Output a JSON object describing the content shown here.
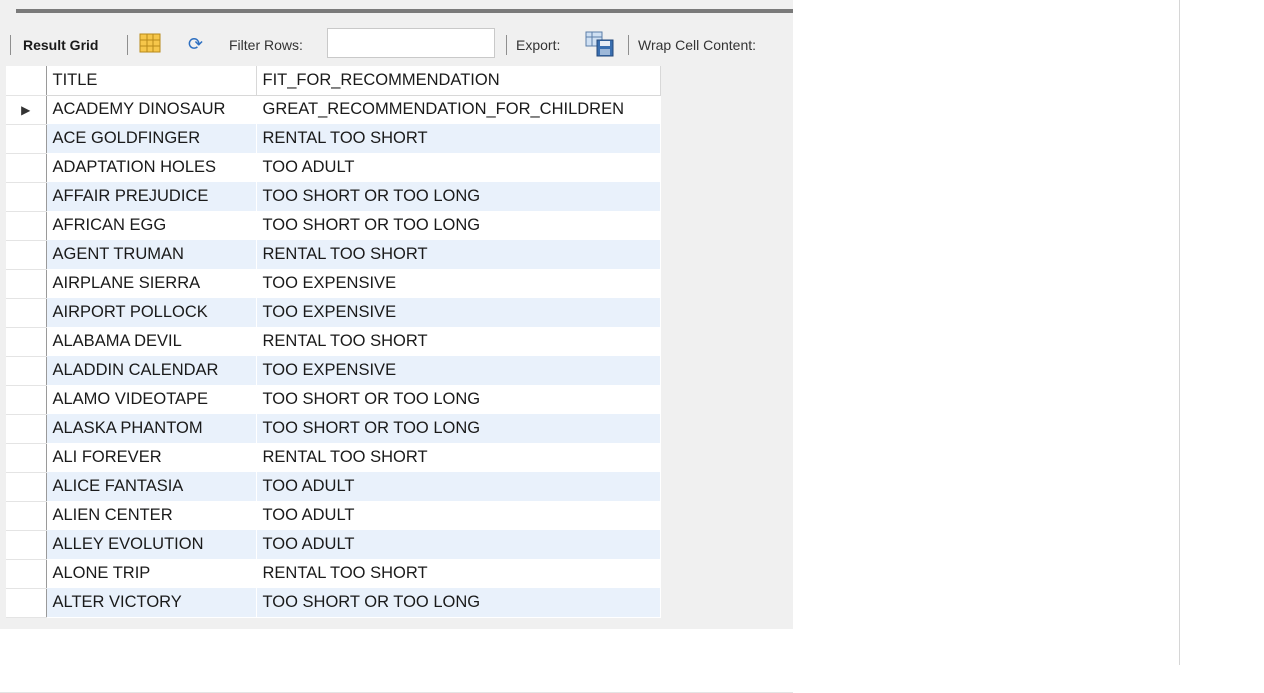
{
  "toolbar": {
    "result_grid_label": "Result Grid",
    "filter_rows_label": "Filter Rows:",
    "filter_value": "",
    "export_label": "Export:",
    "wrap_label": "Wrap Cell Content:",
    "icons": [
      "grid-layout-icon",
      "refresh-icon",
      "export-icon"
    ]
  },
  "grid": {
    "columns": [
      "TITLE",
      "FIT_FOR_RECOMMENDATION"
    ],
    "current_row_marker": "▶",
    "rows": [
      [
        "ACADEMY DINOSAUR",
        "GREAT_RECOMMENDATION_FOR_CHILDREN"
      ],
      [
        "ACE GOLDFINGER",
        "RENTAL TOO SHORT"
      ],
      [
        "ADAPTATION HOLES",
        "TOO ADULT"
      ],
      [
        "AFFAIR PREJUDICE",
        "TOO SHORT OR TOO LONG"
      ],
      [
        "AFRICAN EGG",
        "TOO SHORT OR TOO LONG"
      ],
      [
        "AGENT TRUMAN",
        "RENTAL TOO SHORT"
      ],
      [
        "AIRPLANE SIERRA",
        "TOO EXPENSIVE"
      ],
      [
        "AIRPORT POLLOCK",
        "TOO EXPENSIVE"
      ],
      [
        "ALABAMA DEVIL",
        "RENTAL TOO SHORT"
      ],
      [
        "ALADDIN CALENDAR",
        "TOO EXPENSIVE"
      ],
      [
        "ALAMO VIDEOTAPE",
        "TOO SHORT OR TOO LONG"
      ],
      [
        "ALASKA PHANTOM",
        "TOO SHORT OR TOO LONG"
      ],
      [
        "ALI FOREVER",
        "RENTAL TOO SHORT"
      ],
      [
        "ALICE FANTASIA",
        "TOO ADULT"
      ],
      [
        "ALIEN CENTER",
        "TOO ADULT"
      ],
      [
        "ALLEY EVOLUTION",
        "TOO ADULT"
      ],
      [
        "ALONE TRIP",
        "RENTAL TOO SHORT"
      ],
      [
        "ALTER VICTORY",
        "TOO SHORT OR TOO LONG"
      ]
    ]
  },
  "colors": {
    "alt_row": "#e9f1fb",
    "toolbar_bg": "#f0f0f0",
    "refresh_icon": "#2d6fc1"
  }
}
